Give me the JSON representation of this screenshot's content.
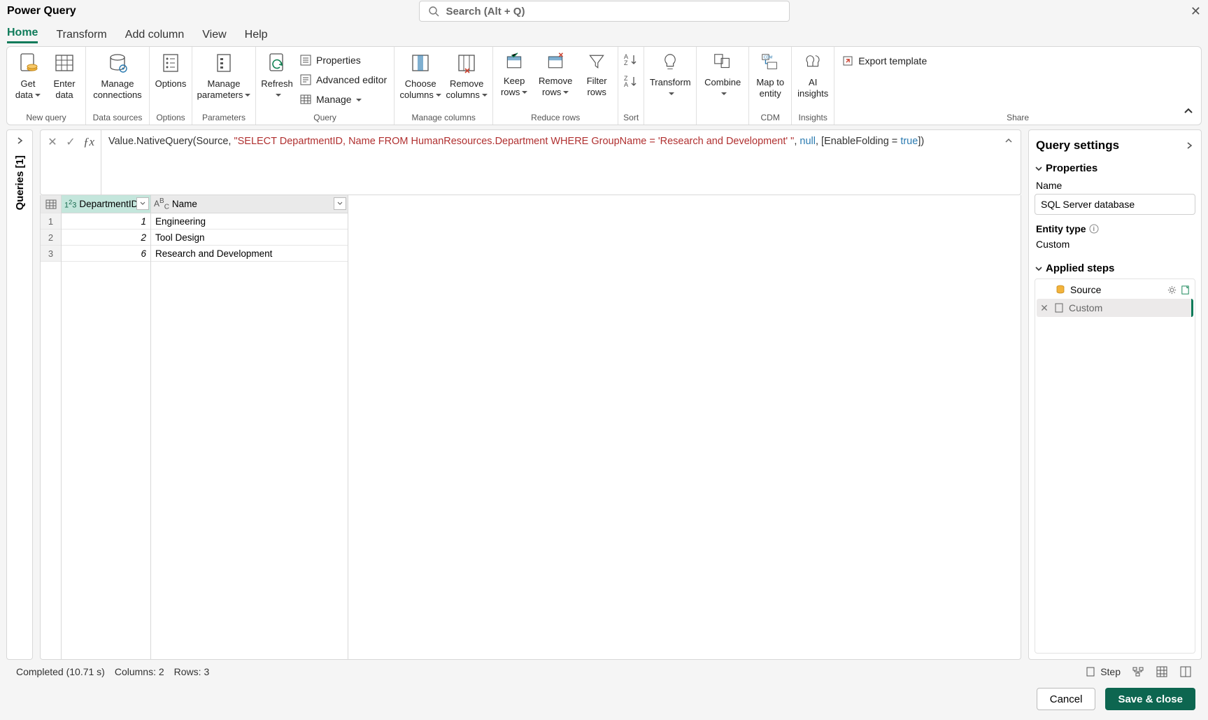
{
  "title": "Power Query",
  "search_placeholder": "Search (Alt + Q)",
  "tabs": [
    "Home",
    "Transform",
    "Add column",
    "View",
    "Help"
  ],
  "active_tab": 0,
  "ribbon": {
    "getdata": "Get data",
    "enterdata": "Enter data",
    "grp_newquery": "New query",
    "manageconn": "Manage connections",
    "grp_datasources": "Data sources",
    "options": "Options",
    "grp_options": "Options",
    "manageparam": "Manage parameters",
    "grp_param": "Parameters",
    "refresh": "Refresh",
    "properties": "Properties",
    "advedit": "Advanced editor",
    "manage": "Manage",
    "grp_query": "Query",
    "choosecols": "Choose columns",
    "removecols": "Remove columns",
    "grp_managecols": "Manage columns",
    "keeprows": "Keep rows",
    "removerows": "Remove rows",
    "filterrows": "Filter rows",
    "grp_reducerows": "Reduce rows",
    "grp_sort": "Sort",
    "transform": "Transform",
    "combine": "Combine",
    "maptoentity": "Map to entity",
    "grp_cdm": "CDM",
    "aiinsights": "AI insights",
    "grp_insights": "Insights",
    "exporttpl": "Export template",
    "grp_share": "Share"
  },
  "queries_label": "Queries [1]",
  "formula": {
    "p1": "Value.NativeQuery(Source, ",
    "str": "\"SELECT DepartmentID, Name FROM HumanResources.Department WHERE GroupName = 'Research and Development'  \"",
    "p2": ", ",
    "null": "null",
    "p3": ", [EnableFolding = ",
    "true": "true",
    "p4": "])"
  },
  "columns": [
    "DepartmentID",
    "Name"
  ],
  "rows": [
    {
      "n": "1",
      "id": "1",
      "name": "Engineering"
    },
    {
      "n": "2",
      "id": "2",
      "name": "Tool Design"
    },
    {
      "n": "3",
      "id": "6",
      "name": "Research and Development"
    }
  ],
  "settings": {
    "title": "Query settings",
    "properties": "Properties",
    "name_lbl": "Name",
    "name_val": "SQL Server database",
    "entity_lbl": "Entity type",
    "entity_val": "Custom",
    "steps_lbl": "Applied steps",
    "step1": "Source",
    "step2": "Custom"
  },
  "status": {
    "completed": "Completed (10.71 s)",
    "columns": "Columns: 2",
    "rows": "Rows: 3",
    "step": "Step"
  },
  "footer": {
    "cancel": "Cancel",
    "save": "Save & close"
  }
}
